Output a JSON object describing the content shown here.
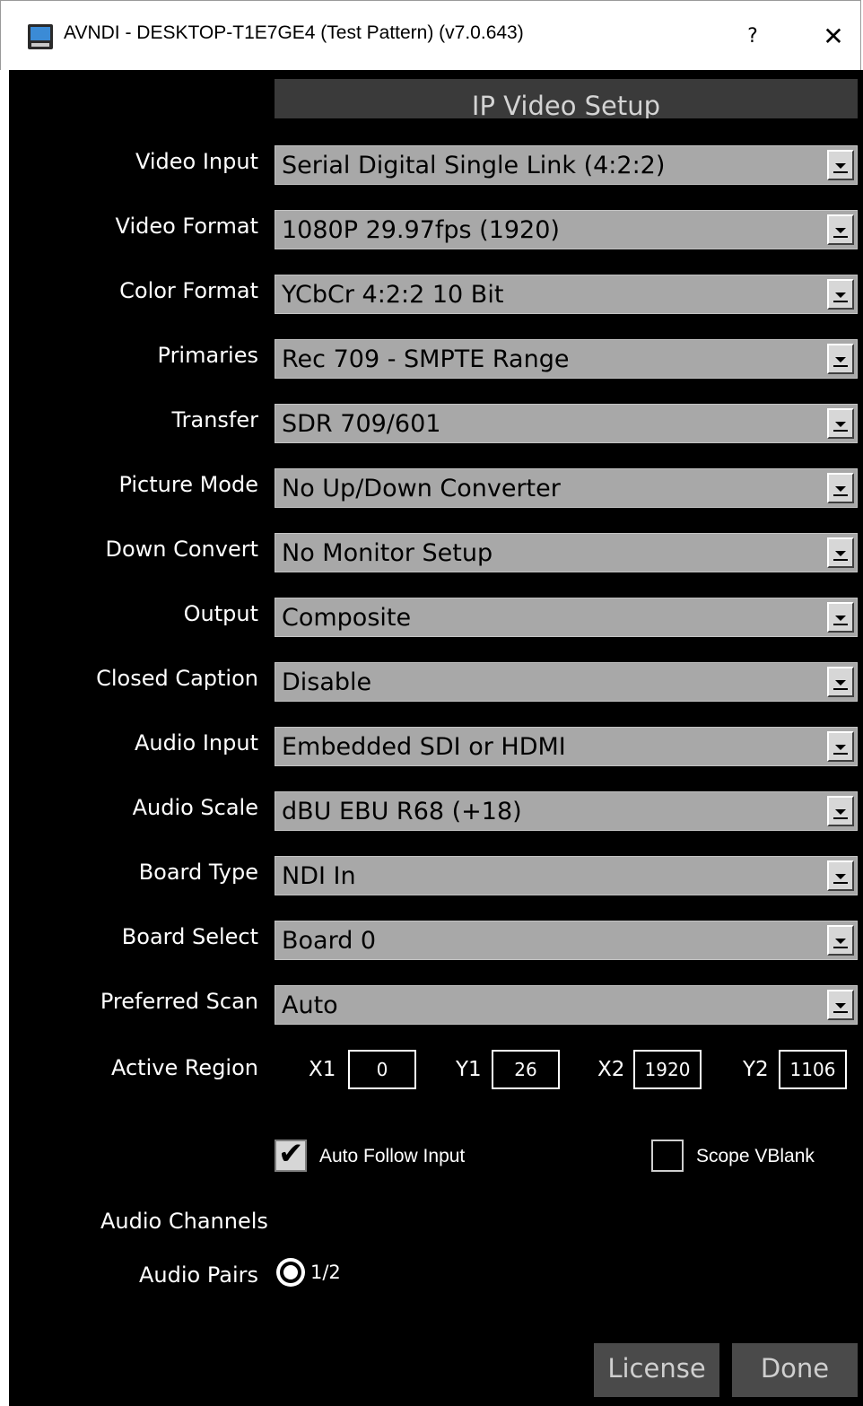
{
  "window": {
    "title": "AVNDI - DESKTOP-T1E7GE4 (Test Pattern) (v7.0.643)",
    "help_label": "?",
    "close_label": "✕"
  },
  "header": {
    "title": "IP Video Setup"
  },
  "rows": [
    {
      "label": "Video Input",
      "value": "Serial Digital Single Link (4:2:2)"
    },
    {
      "label": "Video Format",
      "value": "1080P 29.97fps (1920)"
    },
    {
      "label": "Color Format",
      "value": "YCbCr 4:2:2 10 Bit"
    },
    {
      "label": "Primaries",
      "value": "Rec 709 - SMPTE Range"
    },
    {
      "label": "Transfer",
      "value": "SDR 709/601"
    },
    {
      "label": "Picture Mode",
      "value": "No Up/Down Converter"
    },
    {
      "label": "Down Convert",
      "value": "No Monitor Setup"
    },
    {
      "label": "Output",
      "value": "Composite"
    },
    {
      "label": "Closed Caption",
      "value": "Disable"
    },
    {
      "label": "Audio Input",
      "value": "Embedded SDI or HDMI"
    },
    {
      "label": "Audio Scale",
      "value": "dBU EBU R68 (+18)"
    },
    {
      "label": "Board Type",
      "value": "NDI In"
    },
    {
      "label": "Board Select",
      "value": "Board 0"
    },
    {
      "label": "Preferred Scan",
      "value": "Auto"
    }
  ],
  "active_region": {
    "label": "Active Region",
    "x1_label": "X1",
    "x1": "0",
    "y1_label": "Y1",
    "y1": "26",
    "x2_label": "X2",
    "x2": "1920",
    "y2_label": "Y2",
    "y2": "1106"
  },
  "checkboxes": {
    "auto_follow_label": "Auto Follow Input",
    "auto_follow_checked": true,
    "scope_vblank_label": "Scope VBlank",
    "scope_vblank_checked": false
  },
  "audio": {
    "channels_label": "Audio Channels",
    "pairs_label": "Audio Pairs",
    "pair_option": "1/2"
  },
  "buttons": {
    "license": "License",
    "done": "Done"
  },
  "colors": {
    "dialog_bg": "#000000",
    "select_bg": "#a8a8a8",
    "button_bg": "#4a4a4a"
  }
}
